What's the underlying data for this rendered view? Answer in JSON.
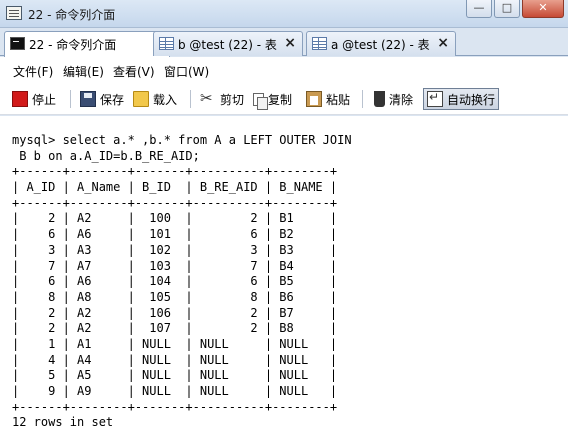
{
  "window": {
    "title": "22 - 命令列介面",
    "minimize": "—",
    "maximize": "□",
    "close": "✕"
  },
  "tabs": [
    {
      "label": "22 - 命令列介面",
      "icon": "terminal-icon",
      "active": true
    },
    {
      "label": "b @test (22) - 表",
      "icon": "table-icon",
      "active": false
    },
    {
      "label": "a @test (22) - 表",
      "icon": "table-icon",
      "active": false
    }
  ],
  "tab_close": "×",
  "menu": [
    "文件(F)",
    "编辑(E)",
    "查看(V)",
    "窗口(W)"
  ],
  "toolbar": {
    "stop": "停止",
    "save": "保存",
    "load": "载入",
    "cut": "剪切",
    "copy": "复制",
    "paste": "粘贴",
    "clear": "清除",
    "wrap": "自动换行"
  },
  "console": {
    "lines": [
      "mysql> select a.* ,b.* from A a LEFT OUTER JOIN",
      " B b on a.A_ID=b.B_RE_AID;",
      "+------+--------+-------+----------+--------+",
      "| A_ID | A_Name | B_ID  | B_RE_AID | B_NAME |",
      "+------+--------+-------+----------+--------+",
      "|    2 | A2     |  100  |        2 | B1     |",
      "|    6 | A6     |  101  |        6 | B2     |",
      "|    3 | A3     |  102  |        3 | B3     |",
      "|    7 | A7     |  103  |        7 | B4     |",
      "|    6 | A6     |  104  |        6 | B5     |",
      "|    8 | A8     |  105  |        8 | B6     |",
      "|    2 | A2     |  106  |        2 | B7     |",
      "|    2 | A2     |  107  |        2 | B8     |",
      "|    1 | A1     | NULL  | NULL     | NULL   |",
      "|    4 | A4     | NULL  | NULL     | NULL   |",
      "|    5 | A5     | NULL  | NULL     | NULL   |",
      "|    9 | A9     | NULL  | NULL     | NULL   |",
      "+------+--------+-------+----------+--------+",
      "12 rows in set"
    ]
  }
}
